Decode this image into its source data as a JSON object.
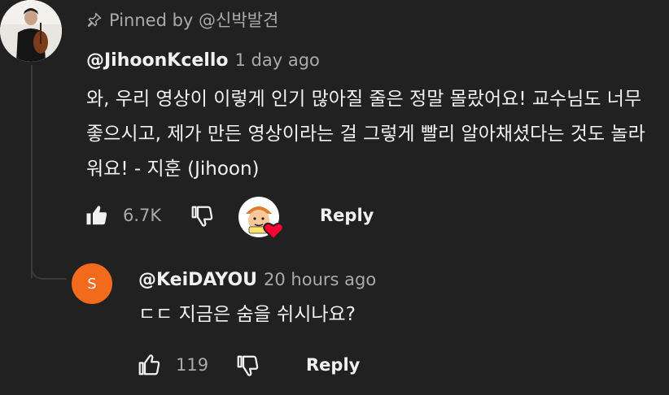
{
  "pinned_comment": {
    "pinned_label": "Pinned by @신박발견",
    "author": "@JihoonKcello",
    "time": "1 day ago",
    "text": "와, 우리 영상이 이렇게 인기 많아질 줄은 정말 몰랐어요! 교수님도 너무 좋으시고, 제가 만든 영상이라는 걸 그렇게 빨리 알아채셨다는 것도 놀라워요! - 지훈 (Jihoon)",
    "like_count": "6.7K",
    "reply_label": "Reply"
  },
  "reply_comment": {
    "avatar_letter": "S",
    "author": "@KeiDAYOU",
    "time": "20 hours ago",
    "text": "ㄷㄷ 지금은 숨을 쉬시나요?",
    "like_count": "119",
    "reply_label": "Reply"
  },
  "icons": {
    "pin": "pin-icon",
    "like_filled": "thumbs-up-filled-icon",
    "like_outline": "thumbs-up-outline-icon",
    "dislike": "thumbs-down-outline-icon",
    "creator_heart": "creator-heart-badge"
  },
  "colors": {
    "background": "#212121",
    "primary_text": "#f1f1f1",
    "secondary_text": "#aaaaaa",
    "reply_avatar": "#f26b1d",
    "heart": "#ff0033"
  }
}
